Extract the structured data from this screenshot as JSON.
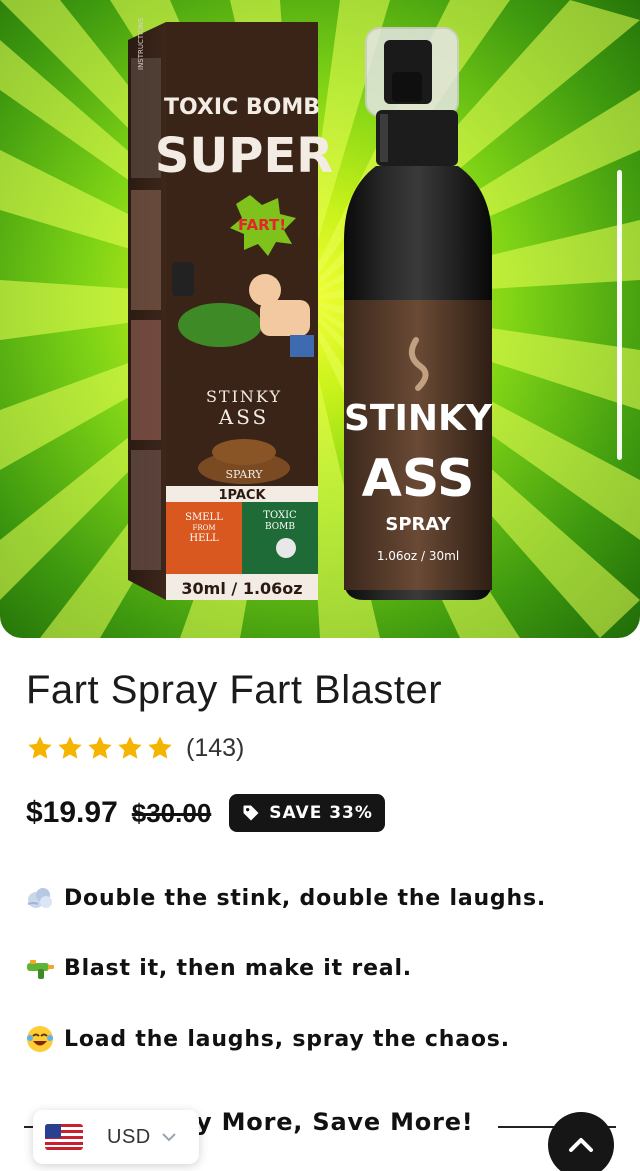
{
  "product": {
    "title": "Fart Spray Fart Blaster",
    "rating_count": "(143)",
    "rating_stars": 5,
    "price": "$19.97",
    "compare_price": "$30.00",
    "save_label": "SAVE 33%"
  },
  "image": {
    "box_text": {
      "instructions": "INSTRUCTIONS",
      "brand_line1": "TOXIC BOMB",
      "brand_line2": "SUPER",
      "burst": "FART!",
      "stinky": "STINKY",
      "ass": "ASS",
      "spary": "SPARY",
      "pack": "1PACK",
      "smell": "SMELL",
      "from": "FROM",
      "hell": "HELL",
      "toxic": "TOXIC",
      "bomb": "BOMB",
      "volume": "30ml / 1.06oz"
    },
    "bottle_text": {
      "stinky": "STINKY",
      "ass": "ASS",
      "spray": "SPRAY",
      "volume": "1.06oz / 30ml"
    }
  },
  "features": [
    {
      "icon": "wind-puff-icon",
      "text": "Double the stink, double the laughs."
    },
    {
      "icon": "water-gun-icon",
      "text": "Blast it, then make it real."
    },
    {
      "icon": "laughing-face-icon",
      "text": "Load the laughs, spray the chaos."
    }
  ],
  "promo": {
    "text": "y More, Save More!"
  },
  "currency": {
    "code": "USD"
  },
  "colors": {
    "accent_star": "#f5b400",
    "badge_bg": "#151515",
    "hero_green": "#7fd316",
    "box_brown": "#3a2418"
  }
}
